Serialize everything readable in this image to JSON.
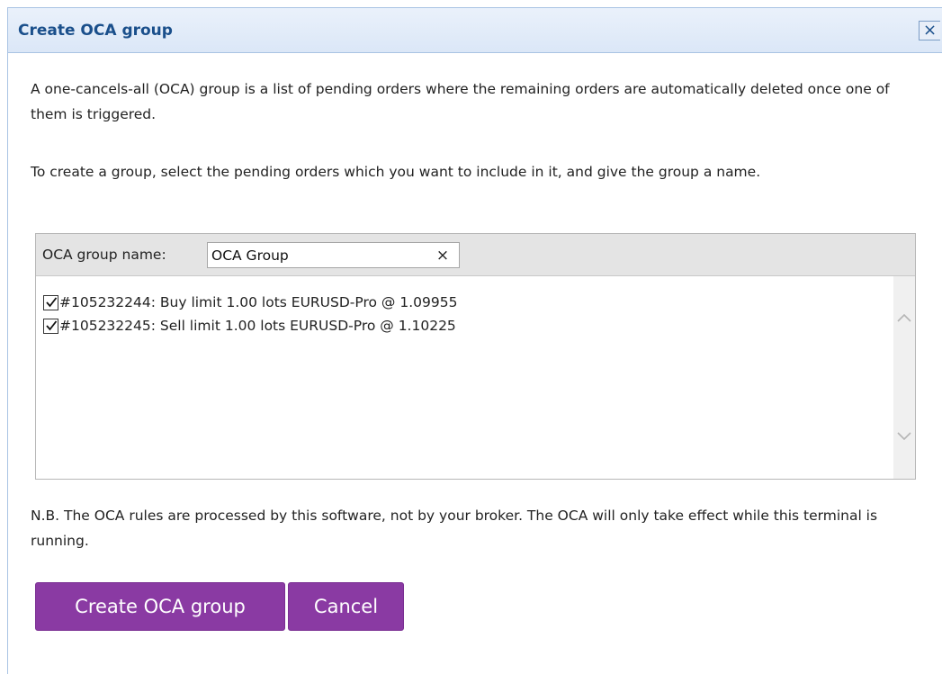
{
  "dialog": {
    "title": "Create OCA group",
    "close_label": "×"
  },
  "intro": {
    "paragraph1": "A one-cancels-all (OCA) group is a list of pending orders where the remaining orders are automatically deleted once one of them is triggered.",
    "paragraph2": "To create a group, select the pending orders which you want to include in it, and give the group a name."
  },
  "group": {
    "name_label": "OCA group name:",
    "name_value": "OCA Group",
    "clear_label": "×"
  },
  "orders": [
    {
      "checked": true,
      "text": "#105232244: Buy limit 1.00 lots EURUSD-Pro @ 1.09955"
    },
    {
      "checked": true,
      "text": "#105232245: Sell limit 1.00 lots EURUSD-Pro @ 1.10225"
    }
  ],
  "note": "N.B. The OCA rules are processed by this software, not by your broker. The OCA will only take effect while this terminal is running.",
  "buttons": {
    "create_label": "Create OCA group",
    "cancel_label": "Cancel"
  },
  "colors": {
    "title_text": "#1a4f8b",
    "titlebar_bg": "#dbe7f7",
    "button_bg": "#8a3aa3",
    "button_text": "#ffffff",
    "group_header_bg": "#e4e4e4"
  },
  "icons": {
    "close": "close-icon",
    "clear": "clear-icon",
    "check": "checkmark-icon",
    "scroll_up": "chevron-up-icon",
    "scroll_down": "chevron-down-icon"
  }
}
